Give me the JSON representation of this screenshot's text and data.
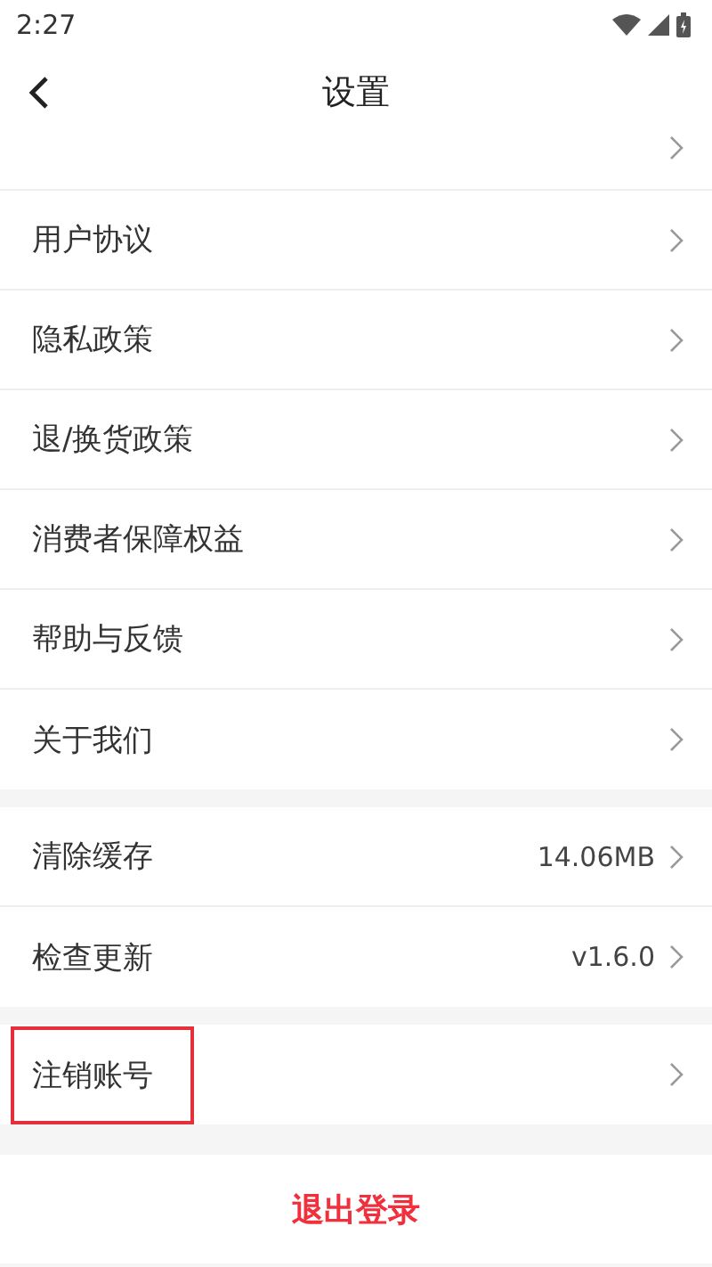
{
  "status_bar": {
    "time": "2:27"
  },
  "header": {
    "title": "设置"
  },
  "groups": [
    {
      "items": [
        {
          "label": "用户协议",
          "highlighted": false
        },
        {
          "label": "隐私政策",
          "highlighted": false
        },
        {
          "label": "退/换货政策",
          "highlighted": false
        },
        {
          "label": "消费者保障权益",
          "highlighted": false
        },
        {
          "label": "帮助与反馈",
          "highlighted": false
        },
        {
          "label": "关于我们",
          "highlighted": false
        }
      ]
    },
    {
      "items": [
        {
          "label": "清除缓存",
          "value": "14.06MB",
          "highlighted": false
        },
        {
          "label": "检查更新",
          "value": "v1.6.0",
          "highlighted": false
        }
      ]
    },
    {
      "items": [
        {
          "label": "注销账号",
          "highlighted": true
        }
      ]
    }
  ],
  "logout_button": "退出登录"
}
